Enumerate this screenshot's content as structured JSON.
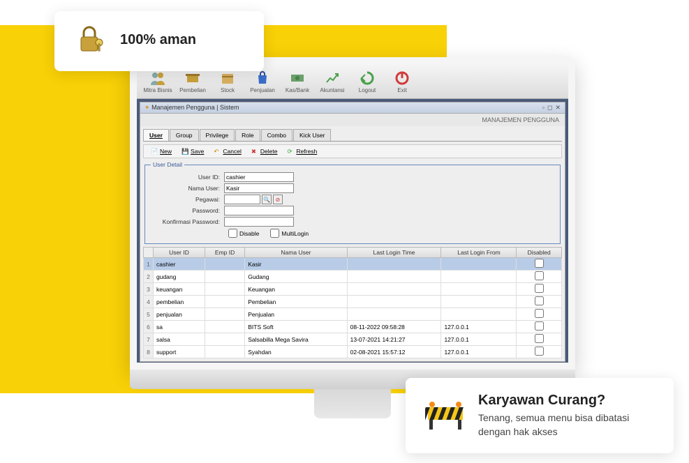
{
  "callouts": {
    "top": {
      "title": "100% aman"
    },
    "bottom": {
      "title": "Karyawan Curang?",
      "body": "Tenang, semua menu bisa dibatasi dengan hak akses"
    }
  },
  "toolbar": [
    {
      "label": "Mitra Bisnis",
      "icon": "users",
      "color": "#8a8"
    },
    {
      "label": "Pembelian",
      "icon": "cart",
      "color": "#c9a13a"
    },
    {
      "label": "Stock",
      "icon": "box",
      "color": "#c9a13a"
    },
    {
      "label": "Penjualan",
      "icon": "bag",
      "color": "#3a6cc9"
    },
    {
      "label": "Kas/Bank",
      "icon": "money",
      "color": "#6aa06a"
    },
    {
      "label": "Akuntansi",
      "icon": "chart",
      "color": "#4aa04a"
    },
    {
      "label": "Logout",
      "icon": "logout",
      "color": "#4aa04a"
    },
    {
      "label": "Exit",
      "icon": "power",
      "color": "#d03a3a"
    }
  ],
  "subwindow": {
    "title": "Manajemen Pengguna | Sistem",
    "page_header": "MANAJEMEN PENGGUNA"
  },
  "tabs": [
    "User",
    "Group",
    "Privilege",
    "Role",
    "Combo",
    "Kick User"
  ],
  "actions": {
    "new": "New",
    "save": "Save",
    "cancel": "Cancel",
    "delete": "Delete",
    "refresh": "Refresh"
  },
  "user_detail": {
    "legend": "User Detail",
    "labels": {
      "user_id": "User ID:",
      "nama_user": "Nama User:",
      "pegawai": "Pegawai:",
      "password": "Password:",
      "konfirmasi": "Konfirmasi Password:",
      "disable": "Disable",
      "multilogin": "MultiLogin"
    },
    "values": {
      "user_id": "cashier",
      "nama_user": "Kasir",
      "pegawai": "",
      "password": "",
      "konfirmasi": ""
    }
  },
  "table": {
    "columns": [
      "User ID",
      "Emp ID",
      "Nama User",
      "Last Login Time",
      "Last Login From",
      "Disabled"
    ],
    "rows": [
      {
        "n": 1,
        "user_id": "cashier",
        "emp_id": "",
        "nama_user": "Kasir",
        "last_time": "",
        "last_from": "",
        "disabled": false,
        "selected": true
      },
      {
        "n": 2,
        "user_id": "gudang",
        "emp_id": "",
        "nama_user": "Gudang",
        "last_time": "",
        "last_from": "",
        "disabled": false
      },
      {
        "n": 3,
        "user_id": "keuangan",
        "emp_id": "",
        "nama_user": "Keuangan",
        "last_time": "",
        "last_from": "",
        "disabled": false
      },
      {
        "n": 4,
        "user_id": "pembelian",
        "emp_id": "",
        "nama_user": "Pembelian",
        "last_time": "",
        "last_from": "",
        "disabled": false
      },
      {
        "n": 5,
        "user_id": "penjualan",
        "emp_id": "",
        "nama_user": "Penjualan",
        "last_time": "",
        "last_from": "",
        "disabled": false
      },
      {
        "n": 6,
        "user_id": "sa",
        "emp_id": "",
        "nama_user": "BITS Soft",
        "last_time": "08-11-2022 09:58:28",
        "last_from": "127.0.0.1",
        "disabled": false
      },
      {
        "n": 7,
        "user_id": "salsa",
        "emp_id": "",
        "nama_user": "Salsabilla Mega Savira",
        "last_time": "13-07-2021 14:21:27",
        "last_from": "127.0.0.1",
        "disabled": false
      },
      {
        "n": 8,
        "user_id": "support",
        "emp_id": "",
        "nama_user": "Syahdan",
        "last_time": "02-08-2021 15:57:12",
        "last_from": "127.0.0.1",
        "disabled": false
      }
    ]
  }
}
